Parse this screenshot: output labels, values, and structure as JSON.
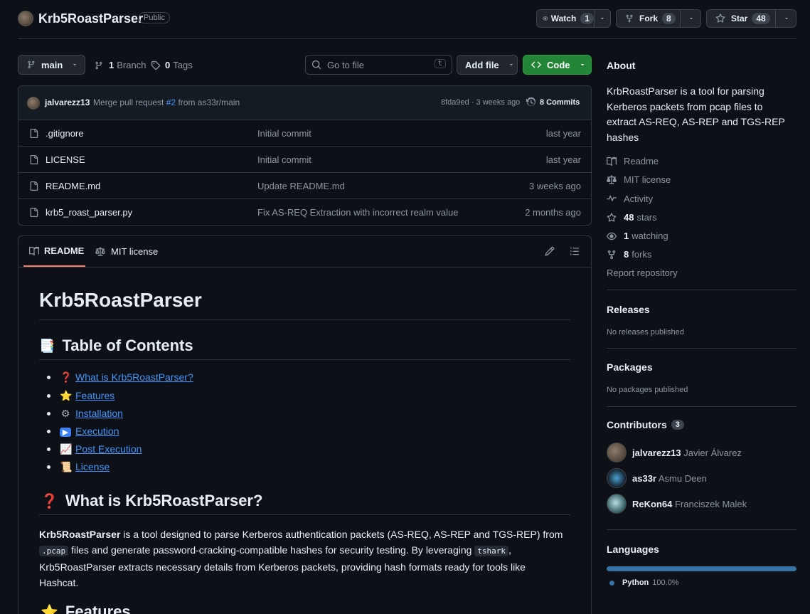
{
  "repo": {
    "name": "Krb5RoastParser",
    "visibility": "Public",
    "watch_label": "Watch",
    "watch_count": "1",
    "fork_label": "Fork",
    "fork_count": "8",
    "star_label": "Star",
    "star_count": "48"
  },
  "toolbar": {
    "branch": "main",
    "branches_count": "1",
    "branches_label": "Branch",
    "tags_count": "0",
    "tags_label": "Tags",
    "search_placeholder": "Go to file",
    "search_kbd": "t",
    "add_file_label": "Add file",
    "code_label": "Code"
  },
  "commit": {
    "author": "jalvarezz13",
    "message_prefix": "Merge pull request",
    "pr_link": "#2",
    "message_suffix": "from as33r/main",
    "meta": "8fda9ed · 3 weeks ago",
    "commits_count": "8 Commits"
  },
  "files": [
    {
      "name": ".gitignore",
      "message": "Initial commit",
      "date": "last year"
    },
    {
      "name": "LICENSE",
      "message": "Initial commit",
      "date": "last year"
    },
    {
      "name": "README.md",
      "message": "Update README.md",
      "date": "3 weeks ago"
    },
    {
      "name": "krb5_roast_parser.py",
      "message": "Fix AS-REQ Extraction with incorrect realm value",
      "date": "2 months ago"
    }
  ],
  "readme": {
    "tab_readme": "README",
    "tab_license": "MIT license",
    "h1": "Krb5RoastParser",
    "toc_title": "Table of Contents",
    "toc_emoji": "📑",
    "toc": [
      {
        "emoji": "❓",
        "label": "What is Krb5RoastParser?"
      },
      {
        "emoji": "⭐",
        "label": "Features"
      },
      {
        "emoji": "⚙",
        "label": "Installation"
      },
      {
        "emoji": "▶",
        "label": "Execution"
      },
      {
        "emoji": "📈",
        "label": "Post Execution"
      },
      {
        "emoji": "📜",
        "label": "License"
      }
    ],
    "what_emoji": "❓",
    "what_title": "What is Krb5RoastParser?",
    "para_bold": "Krb5RoastParser",
    "para_1": " is a tool designed to parse Kerberos authentication packets (AS-REQ, AS-REP and TGS-REP) from",
    "para_code1": ".pcap",
    "para_2": " files and generate password-cracking-compatible hashes for security testing. By leveraging ",
    "para_code2": "tshark",
    "para_3": ",",
    "para_4": "Krb5RoastParser extracts necessary details from Kerberos packets, providing hash formats ready for tools like",
    "para_5": "Hashcat.",
    "features_emoji": "⭐",
    "features_title": "Features"
  },
  "about": {
    "title": "About",
    "description": "KrbRoastParser is a tool for parsing Kerberos packets from pcap files to extract AS-REQ, AS-REP and TGS-REP hashes",
    "readme": "Readme",
    "license": "MIT license",
    "activity": "Activity",
    "stars_count": "48",
    "stars_label": "stars",
    "watching_count": "1",
    "watching_label": "watching",
    "forks_count": "8",
    "forks_label": "forks",
    "report": "Report repository"
  },
  "releases": {
    "title": "Releases",
    "empty": "No releases published"
  },
  "packages": {
    "title": "Packages",
    "empty": "No packages published"
  },
  "contributors": {
    "title": "Contributors",
    "count": "3",
    "list": [
      {
        "login": "jalvarezz13",
        "name": "Javier Álvarez"
      },
      {
        "login": "as33r",
        "name": "Asmu Deen"
      },
      {
        "login": "ReKon64",
        "name": "Franciszek Malek"
      }
    ]
  },
  "languages": {
    "title": "Languages",
    "lang": "Python",
    "percent": "100.0%",
    "color": "#3572A5",
    "fraction": 1.0
  }
}
